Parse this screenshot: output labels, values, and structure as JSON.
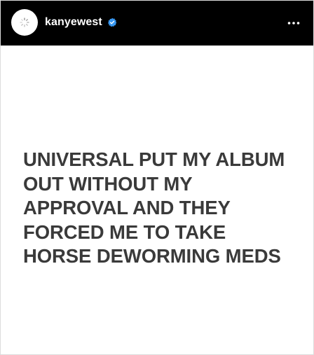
{
  "post": {
    "username": "kanyewest",
    "avatar_icon": "loading-spinner-icon",
    "verified_icon": "verified-badge-icon",
    "more_icon": "more-options-icon",
    "accent_color": "#3897f0",
    "header_bg": "#000000",
    "text_color": "#3a3a3a",
    "text": "UNIVERSAL PUT MY ALBUM\nOUT WITHOUT MY\nAPPROVAL AND THEY\nFORCED ME TO TAKE\nHORSE DEWORMING MEDS"
  }
}
